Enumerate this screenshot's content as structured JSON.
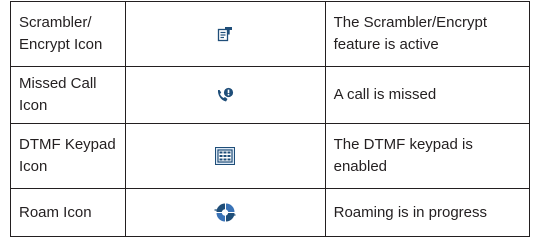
{
  "rows": [
    {
      "name": "Scrambler/ Encrypt Icon",
      "icon": "scrambler-encrypt-icon",
      "description": "The Scrambler/Encrypt feature is active"
    },
    {
      "name": "Missed Call Icon",
      "icon": "missed-call-icon",
      "description": "A call is missed"
    },
    {
      "name": "DTMF Keypad Icon",
      "icon": "dtmf-keypad-icon",
      "description": "The DTMF keypad is enabled"
    },
    {
      "name": "Roam Icon",
      "icon": "roam-icon",
      "description": "Roaming is in progress"
    }
  ],
  "colors": {
    "text": "#231f20",
    "border": "#231f20",
    "icon_dark": "#1f4e79",
    "icon_light": "#3a73b7",
    "icon_fill": "#dce8f5"
  }
}
